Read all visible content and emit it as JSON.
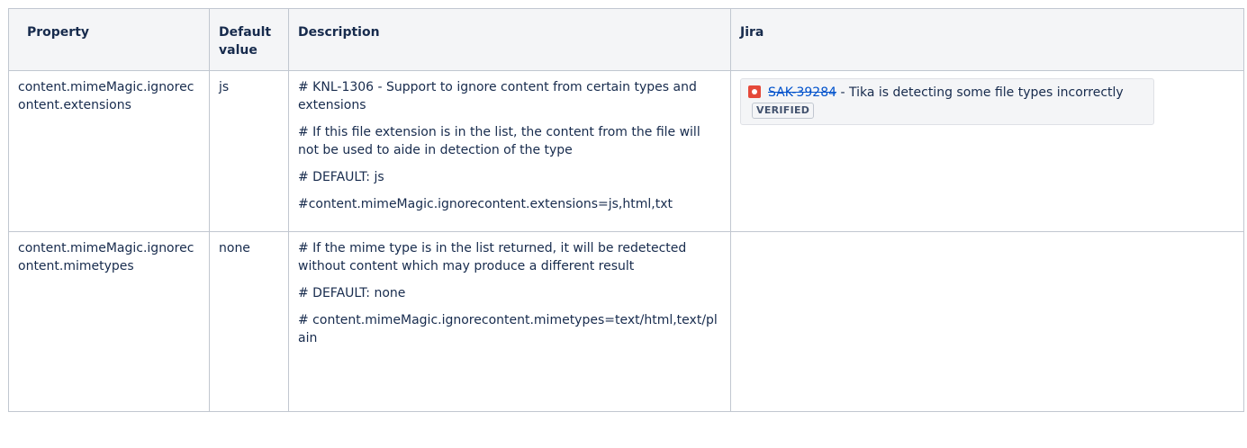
{
  "table": {
    "headers": [
      "Property",
      "Default value",
      "Description",
      "Jira"
    ],
    "rows": [
      {
        "property": "content.mimeMagic.ignorecontent.extensions",
        "default": "js",
        "description": [
          "# KNL-1306 - Support to ignore content from certain types and extensions",
          "# If this file extension is in the list, the content from the file will not be used to aide in detection of the type",
          "# DEFAULT: js",
          "#content.mimeMagic.ignorecontent.extensions=js,html,txt"
        ],
        "jira": {
          "icon": "bug-icon",
          "key": "SAK-39284",
          "separator": " - ",
          "summary": "Tika is detecting some file types incorrectly",
          "status": "VERIFIED"
        }
      },
      {
        "property": "content.mimeMagic.ignorecontent.mimetypes",
        "default": "none",
        "description": [
          "# If the mime type is in the list returned, it will be redetected without content which may produce a different result",
          "# DEFAULT: none",
          "# content.mimeMagic.ignorecontent.mimetypes=text/html,text/plain"
        ],
        "jira": null
      }
    ]
  }
}
